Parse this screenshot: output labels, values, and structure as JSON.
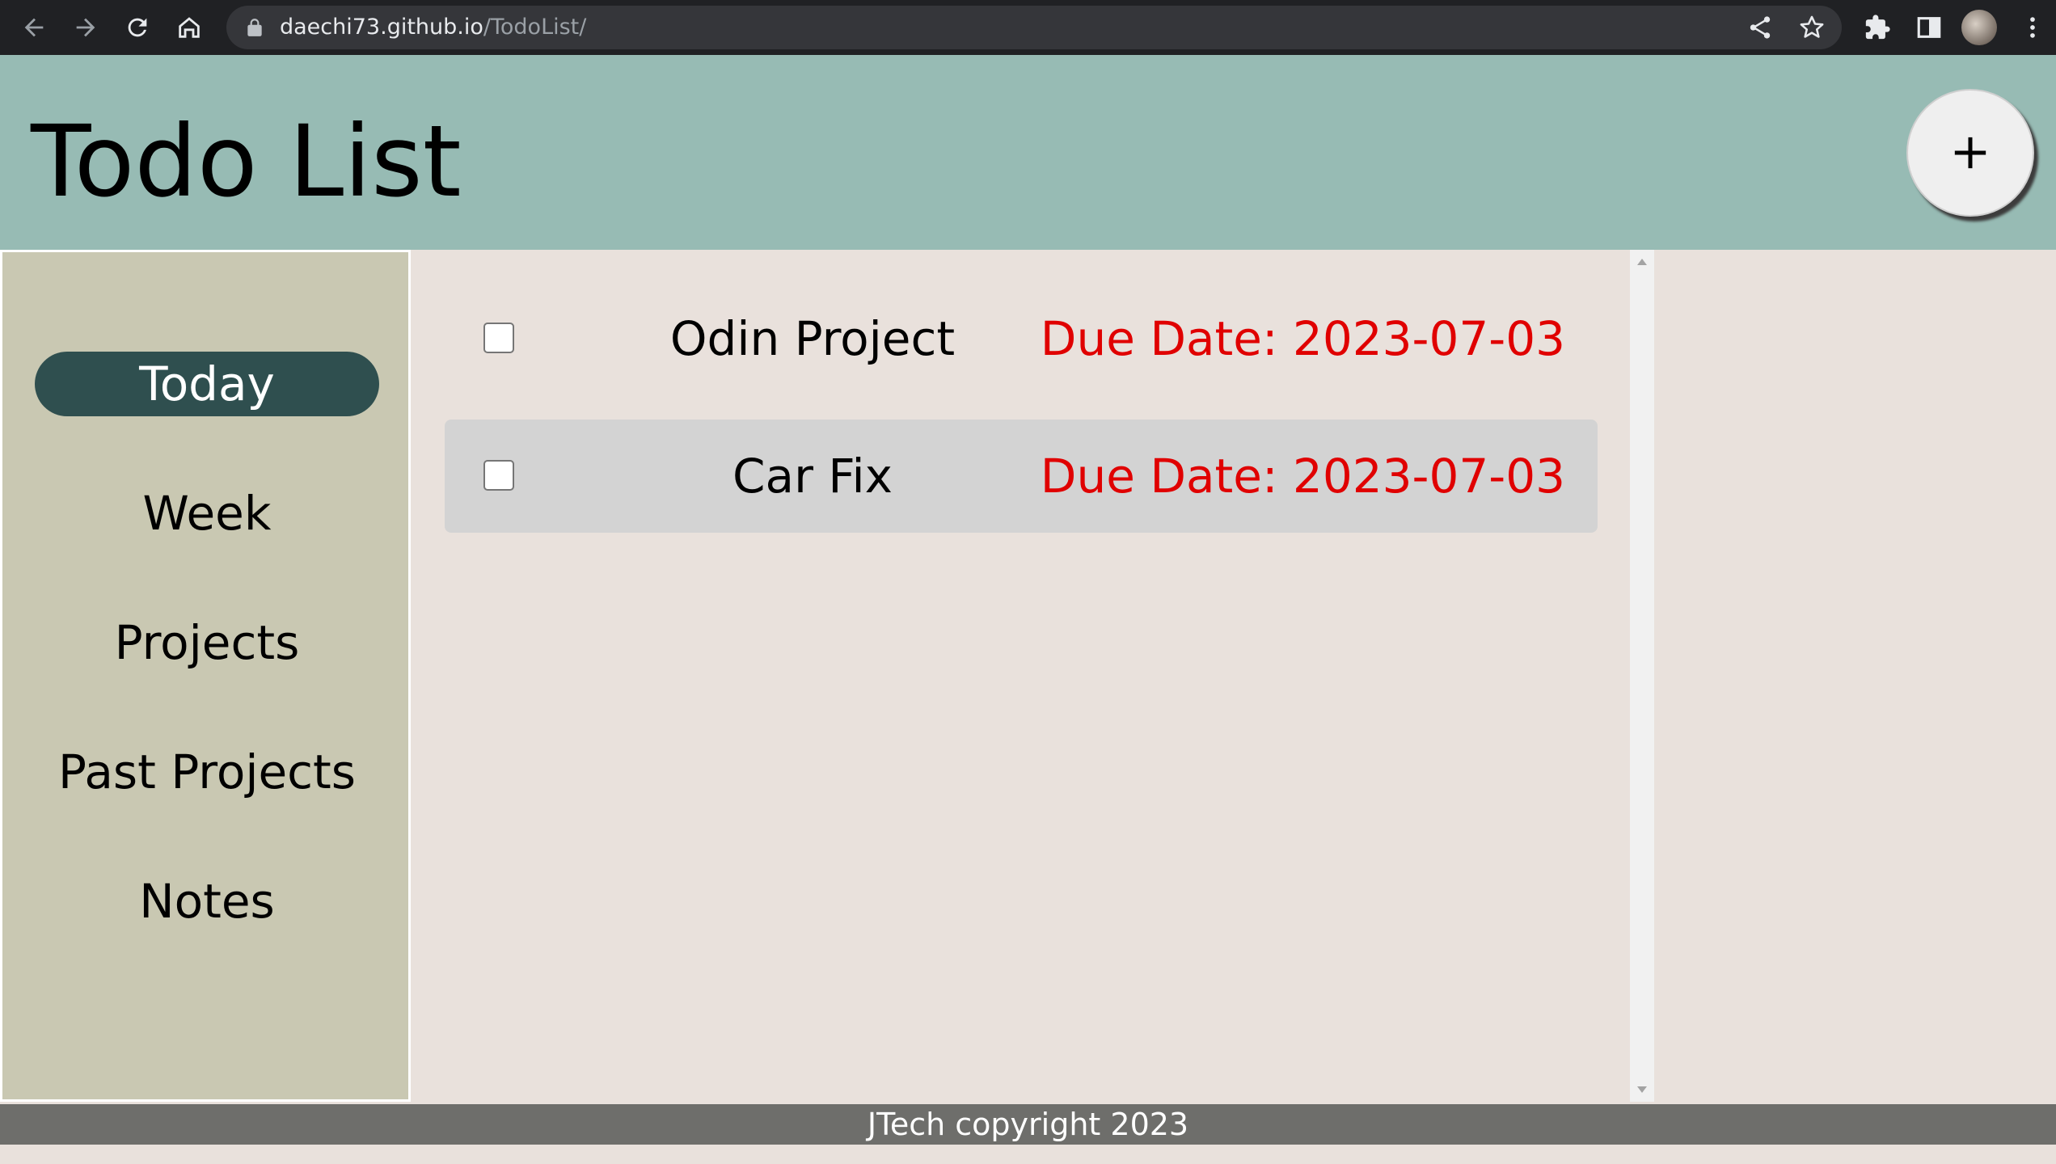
{
  "browser": {
    "url_host": "daechi73.github.io",
    "url_path": "/TodoList/"
  },
  "header": {
    "title": "Todo List",
    "add_label": "+"
  },
  "sidebar": {
    "items": [
      {
        "label": "Today",
        "active": true
      },
      {
        "label": "Week"
      },
      {
        "label": "Projects"
      },
      {
        "label": "Past Projects"
      },
      {
        "label": "Notes"
      }
    ]
  },
  "todos": [
    {
      "title": "Odin Project",
      "due": "Due Date: 2023-07-03",
      "checked": false
    },
    {
      "title": "Car Fix",
      "due": "Due Date: 2023-07-03",
      "checked": false
    }
  ],
  "footer": {
    "text": "JTech copyright 2023"
  },
  "colors": {
    "header_bg": "#97bbb4",
    "sidebar_bg": "#c9c8b2",
    "active_item_bg": "#2f4f4f",
    "main_bg": "#e9e1dc",
    "due_color": "#e00000",
    "footer_bg": "#6e6e6b"
  }
}
